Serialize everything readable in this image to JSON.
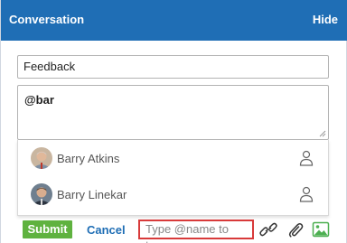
{
  "header": {
    "title": "Conversation",
    "hide_label": "Hide"
  },
  "subject": {
    "value": "Feedback"
  },
  "message": {
    "value": "@bar"
  },
  "suggestions": [
    {
      "name": "Barry Atkins",
      "icon": "person-icon"
    },
    {
      "name": "Barry Linekar",
      "icon": "person-icon"
    }
  ],
  "footer": {
    "submit_label": "Submit",
    "cancel_label": "Cancel",
    "tag_placeholder": "Type @name to tag",
    "icons": [
      "link-icon",
      "paperclip-icon",
      "image-icon"
    ]
  },
  "colors": {
    "header": "#1f6eb5",
    "submit": "#5fb23f",
    "tag_border": "#d83a3a",
    "image_icon": "#4caf50"
  }
}
